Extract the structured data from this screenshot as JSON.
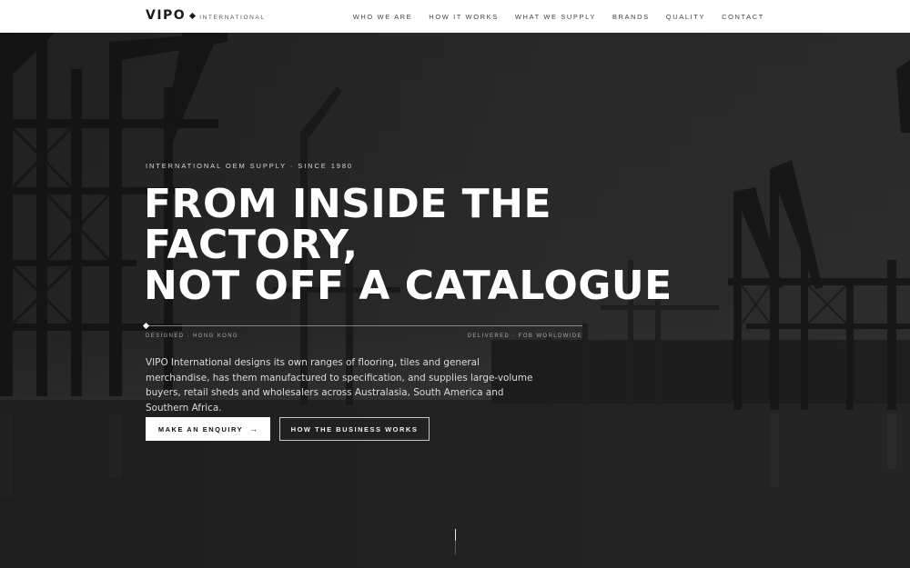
{
  "brand": {
    "name": "VIPO",
    "subtitle": "INTERNATIONAL"
  },
  "nav": {
    "items": [
      {
        "label": "WHO WE ARE"
      },
      {
        "label": "HOW IT WORKS"
      },
      {
        "label": "WHAT WE SUPPLY"
      },
      {
        "label": "BRANDS"
      },
      {
        "label": "QUALITY"
      },
      {
        "label": "CONTACT"
      }
    ]
  },
  "hero": {
    "eyebrow": "INTERNATIONAL OEM SUPPLY · SINCE 1980",
    "headline": {
      "line1": "FROM INSIDE THE",
      "line2": "FACTORY,",
      "line3": "NOT OFF A CATALOGUE"
    },
    "meta_left": "DESIGNED · HONG KONG",
    "meta_right": "DELIVERED · FOB WORLDWIDE",
    "intro": "VIPO International designs its own ranges of flooring, tiles and general merchandise, has them manufactured to specification, and supplies large-volume buyers, retail sheds and wholesalers across Australasia, South America and Southern Africa.",
    "primary_cta": "MAKE AN ENQUIRY",
    "primary_cta_icon": "arrow-right-icon",
    "secondary_cta": "HOW THE BUSINESS WORKS"
  },
  "colors": {
    "header_bg": "#ffffff",
    "hero_overlay": "#2c2b2c",
    "text_light": "#ffffff",
    "accent_dark": "#1b1b1b"
  }
}
